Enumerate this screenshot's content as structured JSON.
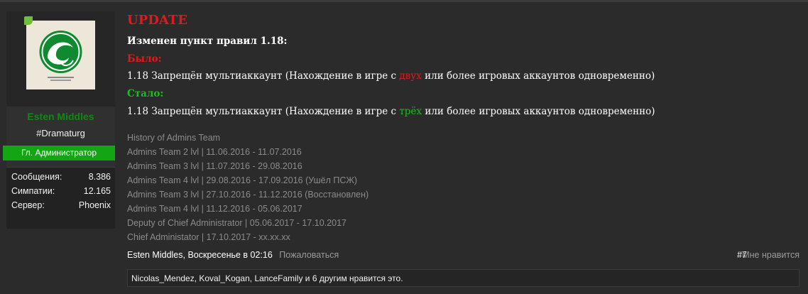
{
  "user": {
    "name": "Esten Middles",
    "title": "#Dramaturg",
    "rank": "Гл. Администратор",
    "stats": [
      {
        "label": "Сообщения:",
        "value": "8.386"
      },
      {
        "label": "Симпатии:",
        "value": "12.165"
      },
      {
        "label": "Сервер:",
        "value": "Phoenix"
      }
    ]
  },
  "post": {
    "heading": "UPDATE",
    "changed_line": "Изменен пункт правил 1.18:",
    "was_label": "Было:",
    "was_text_before": "1.18 Запрещён мультиаккаунт (Нахождение в игре с ",
    "was_highlight": "двух",
    "was_text_after": " или более игровых аккаунтов одновременно)",
    "now_label": "Стало:",
    "now_text_before": "1.18 Запрещён мультиаккаунт (Нахождение в игре с ",
    "now_highlight": "трёх",
    "now_text_after": " или более игровых аккаунтов одновременно)",
    "history": [
      "History of Admins Team",
      "Admins Team 2 lvl | 11.06.2016 - 11.07.2016",
      "Admins Team 3 lvl | 11.07.2016 - 29.08.2016",
      "Admins Team 4 lvl | 29.08.2016 - 17.09.2016 (Ушёл ПСЖ)",
      "Admins Team 3 lvl | 27.10.2016 - 11.12.2016 (Восстановлен)",
      "Admins Team 4 lvl | 11.12.2016 - 05.06.2017",
      "Deputy of Chief Administrator | 05.06.2017 - 17.10.2017",
      "Chief Administator | 17.10.2017 - xx.xx.xx"
    ]
  },
  "meta": {
    "author_date": "Esten Middles, Воскресенье в 02:16",
    "report": "Пожаловаться",
    "post_number": "#7",
    "like": "Мне нравится"
  },
  "likes_summary": "Nicolas_Mendez, Koval_Kogan, LanceFamily и 6 другим нравится это.",
  "colors": {
    "username": "#0d8a10",
    "rank_bg": "#14a514",
    "heading_red": "#e01a1a",
    "highlight_green": "#18c018"
  }
}
